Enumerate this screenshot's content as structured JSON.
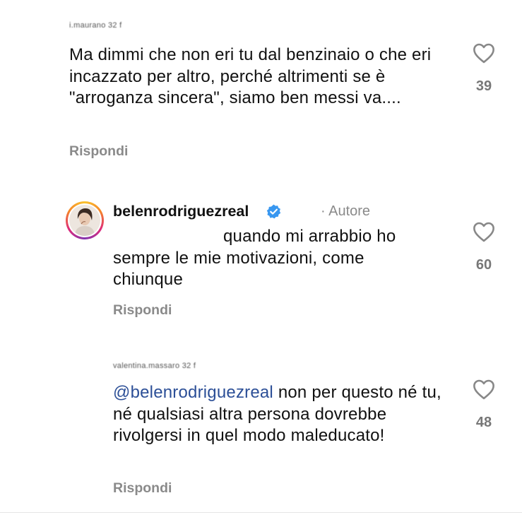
{
  "comments": [
    {
      "username_blurred": "i.maurano 32 f",
      "text": "Ma dimmi che non eri tu dal benzinaio o che eri incazzato per altro, perché altrimenti se è \"arroganza sincera\", siamo ben messi va....",
      "reply_label": "Rispondi",
      "likes": "39"
    },
    {
      "username": "belenrodriguezreal",
      "verified": true,
      "author_tag": "· Autore",
      "text": "quando mi arrabbio ho sempre le mie motivazioni, come chiunque",
      "reply_label": "Rispondi",
      "likes": "60"
    },
    {
      "username_blurred": "valentina.massaro 32 f",
      "mention": "@belenrodriguezreal",
      "text": " non per questo né tu, né qualsiasi altra persona dovrebbe rivolgersi in quel modo maleducato!",
      "reply_label": "Rispondi",
      "likes": "48"
    }
  ],
  "colors": {
    "verified_badge": "#3897f0",
    "mention": "#2c4f97",
    "secondary_text": "#8a8a8a"
  },
  "icons": [
    "heart-icon",
    "verified-badge-icon"
  ]
}
